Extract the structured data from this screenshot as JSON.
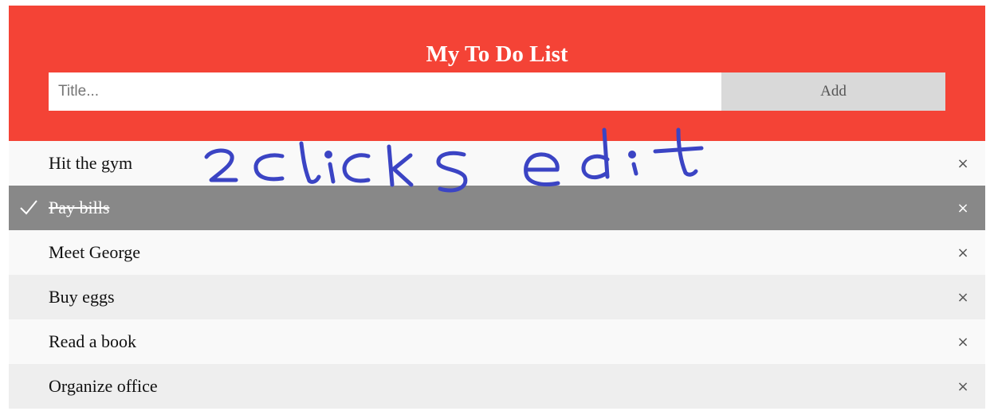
{
  "header": {
    "title": "My To Do List",
    "input_placeholder": "Title...",
    "add_label": "Add",
    "background_color": "#f44336"
  },
  "todos": [
    {
      "text": "Hit the gym",
      "checked": false,
      "close": "×"
    },
    {
      "text": "Pay bills",
      "checked": true,
      "close": "×"
    },
    {
      "text": "Meet George",
      "checked": false,
      "close": "×"
    },
    {
      "text": "Buy eggs",
      "checked": false,
      "close": "×"
    },
    {
      "text": "Read a book",
      "checked": false,
      "close": "×"
    },
    {
      "text": "Organize office",
      "checked": false,
      "close": "×"
    }
  ],
  "annotation": {
    "text": "2 clicks edit",
    "color": "#3b44c4"
  },
  "colors": {
    "checked_bg": "#888888",
    "row_light": "#f9f9f9",
    "row_dark": "#eeeeee",
    "add_button": "#d9d9d9"
  }
}
